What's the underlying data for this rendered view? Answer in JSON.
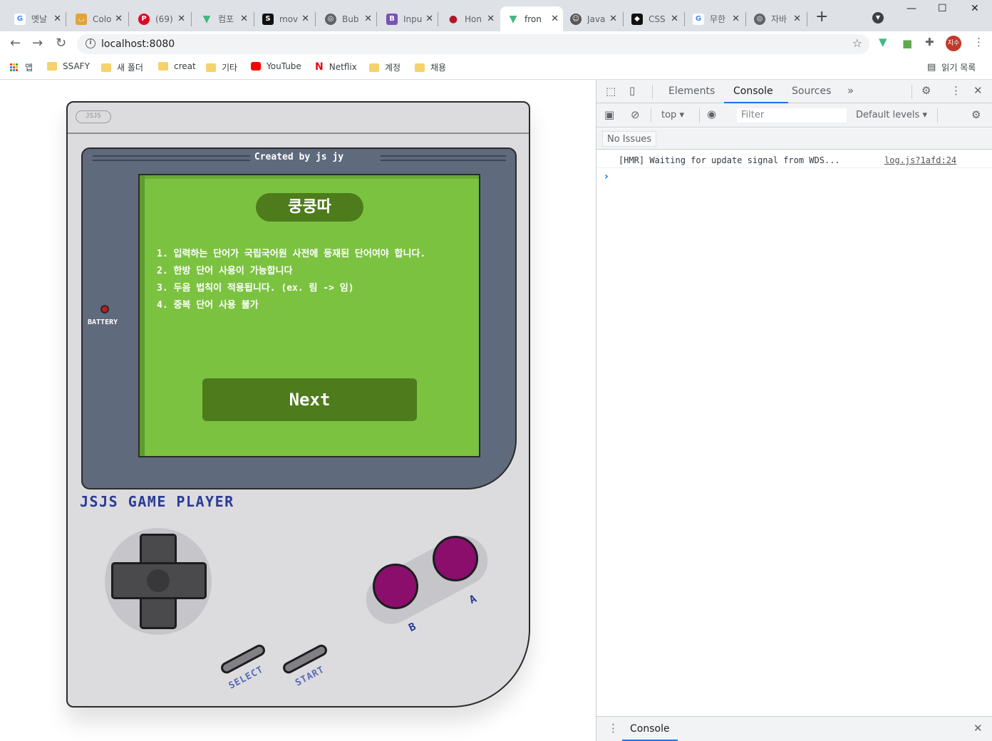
{
  "browser": {
    "tabs": [
      {
        "label": "옛날",
        "icon": "google-icon",
        "color": "#4285f4"
      },
      {
        "label": "Colo",
        "icon": "cup-icon",
        "color": "#e1a33b"
      },
      {
        "label": "(69)",
        "icon": "pinterest-icon",
        "color": "#e60023"
      },
      {
        "label": "컴포",
        "icon": "vue-icon",
        "color": "#41b883"
      },
      {
        "label": "mov",
        "icon": "notion-icon",
        "color": "#111111"
      },
      {
        "label": "Bub",
        "icon": "globe-icon",
        "color": "#5f6368"
      },
      {
        "label": "Inpu",
        "icon": "bootstrap-icon",
        "color": "#7952b3"
      },
      {
        "label": "Hon",
        "icon": "dot-icon",
        "color": "#b5152b"
      },
      {
        "label": "fron",
        "icon": "vue-icon",
        "color": "#41b883",
        "active": true
      },
      {
        "label": "Java",
        "icon": "avatar-icon",
        "color": "#555555"
      },
      {
        "label": "CSS",
        "icon": "codepen-icon",
        "color": "#111111"
      },
      {
        "label": "무한",
        "icon": "google-icon",
        "color": "#4285f4"
      },
      {
        "label": "자바",
        "icon": "globe-icon",
        "color": "#5f6368"
      }
    ],
    "new_tab": "+",
    "url": "localhost:8080",
    "profile_initials": "지수",
    "bookmarks": {
      "apps": "앱",
      "items": [
        "SSAFY",
        "새 폴더",
        "creat",
        "기타",
        "YouTube",
        "Netflix",
        "계정",
        "채용"
      ],
      "reading_list": "읽기 목록"
    }
  },
  "gameboy": {
    "badge": "JSJS",
    "bezel_title": "Created by js jy",
    "battery_label": "BATTERY",
    "game_title": "쿵쿵따",
    "rules": [
      "1. 입력하는 단어가 국립국어원 사전에 등재된 단어여야 합니다.",
      "2. 한방 단어 사용이 가능합니다",
      "3. 두음 법칙이 적용됩니다. (ex. 림 -> 임)",
      "4. 중복 단어 사용 불가"
    ],
    "next_label": "Next",
    "brand": "JSJS GAME PLAYER",
    "button_b": "B",
    "button_a": "A",
    "select_label": "SELECT",
    "start_label": "START",
    "colors": {
      "screen": "#7cc241",
      "screen_dark": "#4e7b1c",
      "bezel": "#5f6a7c",
      "body": "#dcdcdf",
      "ab_buttons": "#8b0e6d",
      "brand_text": "#2b3b94"
    }
  },
  "devtools": {
    "tabs": [
      "Elements",
      "Console",
      "Sources"
    ],
    "active_tab": "Console",
    "context": "top",
    "filter_placeholder": "Filter",
    "levels": "Default levels",
    "issues": "No Issues",
    "log_message": "[HMR] Waiting for update signal from WDS...",
    "log_source": "log.js?1afd:24",
    "drawer_tab": "Console"
  }
}
